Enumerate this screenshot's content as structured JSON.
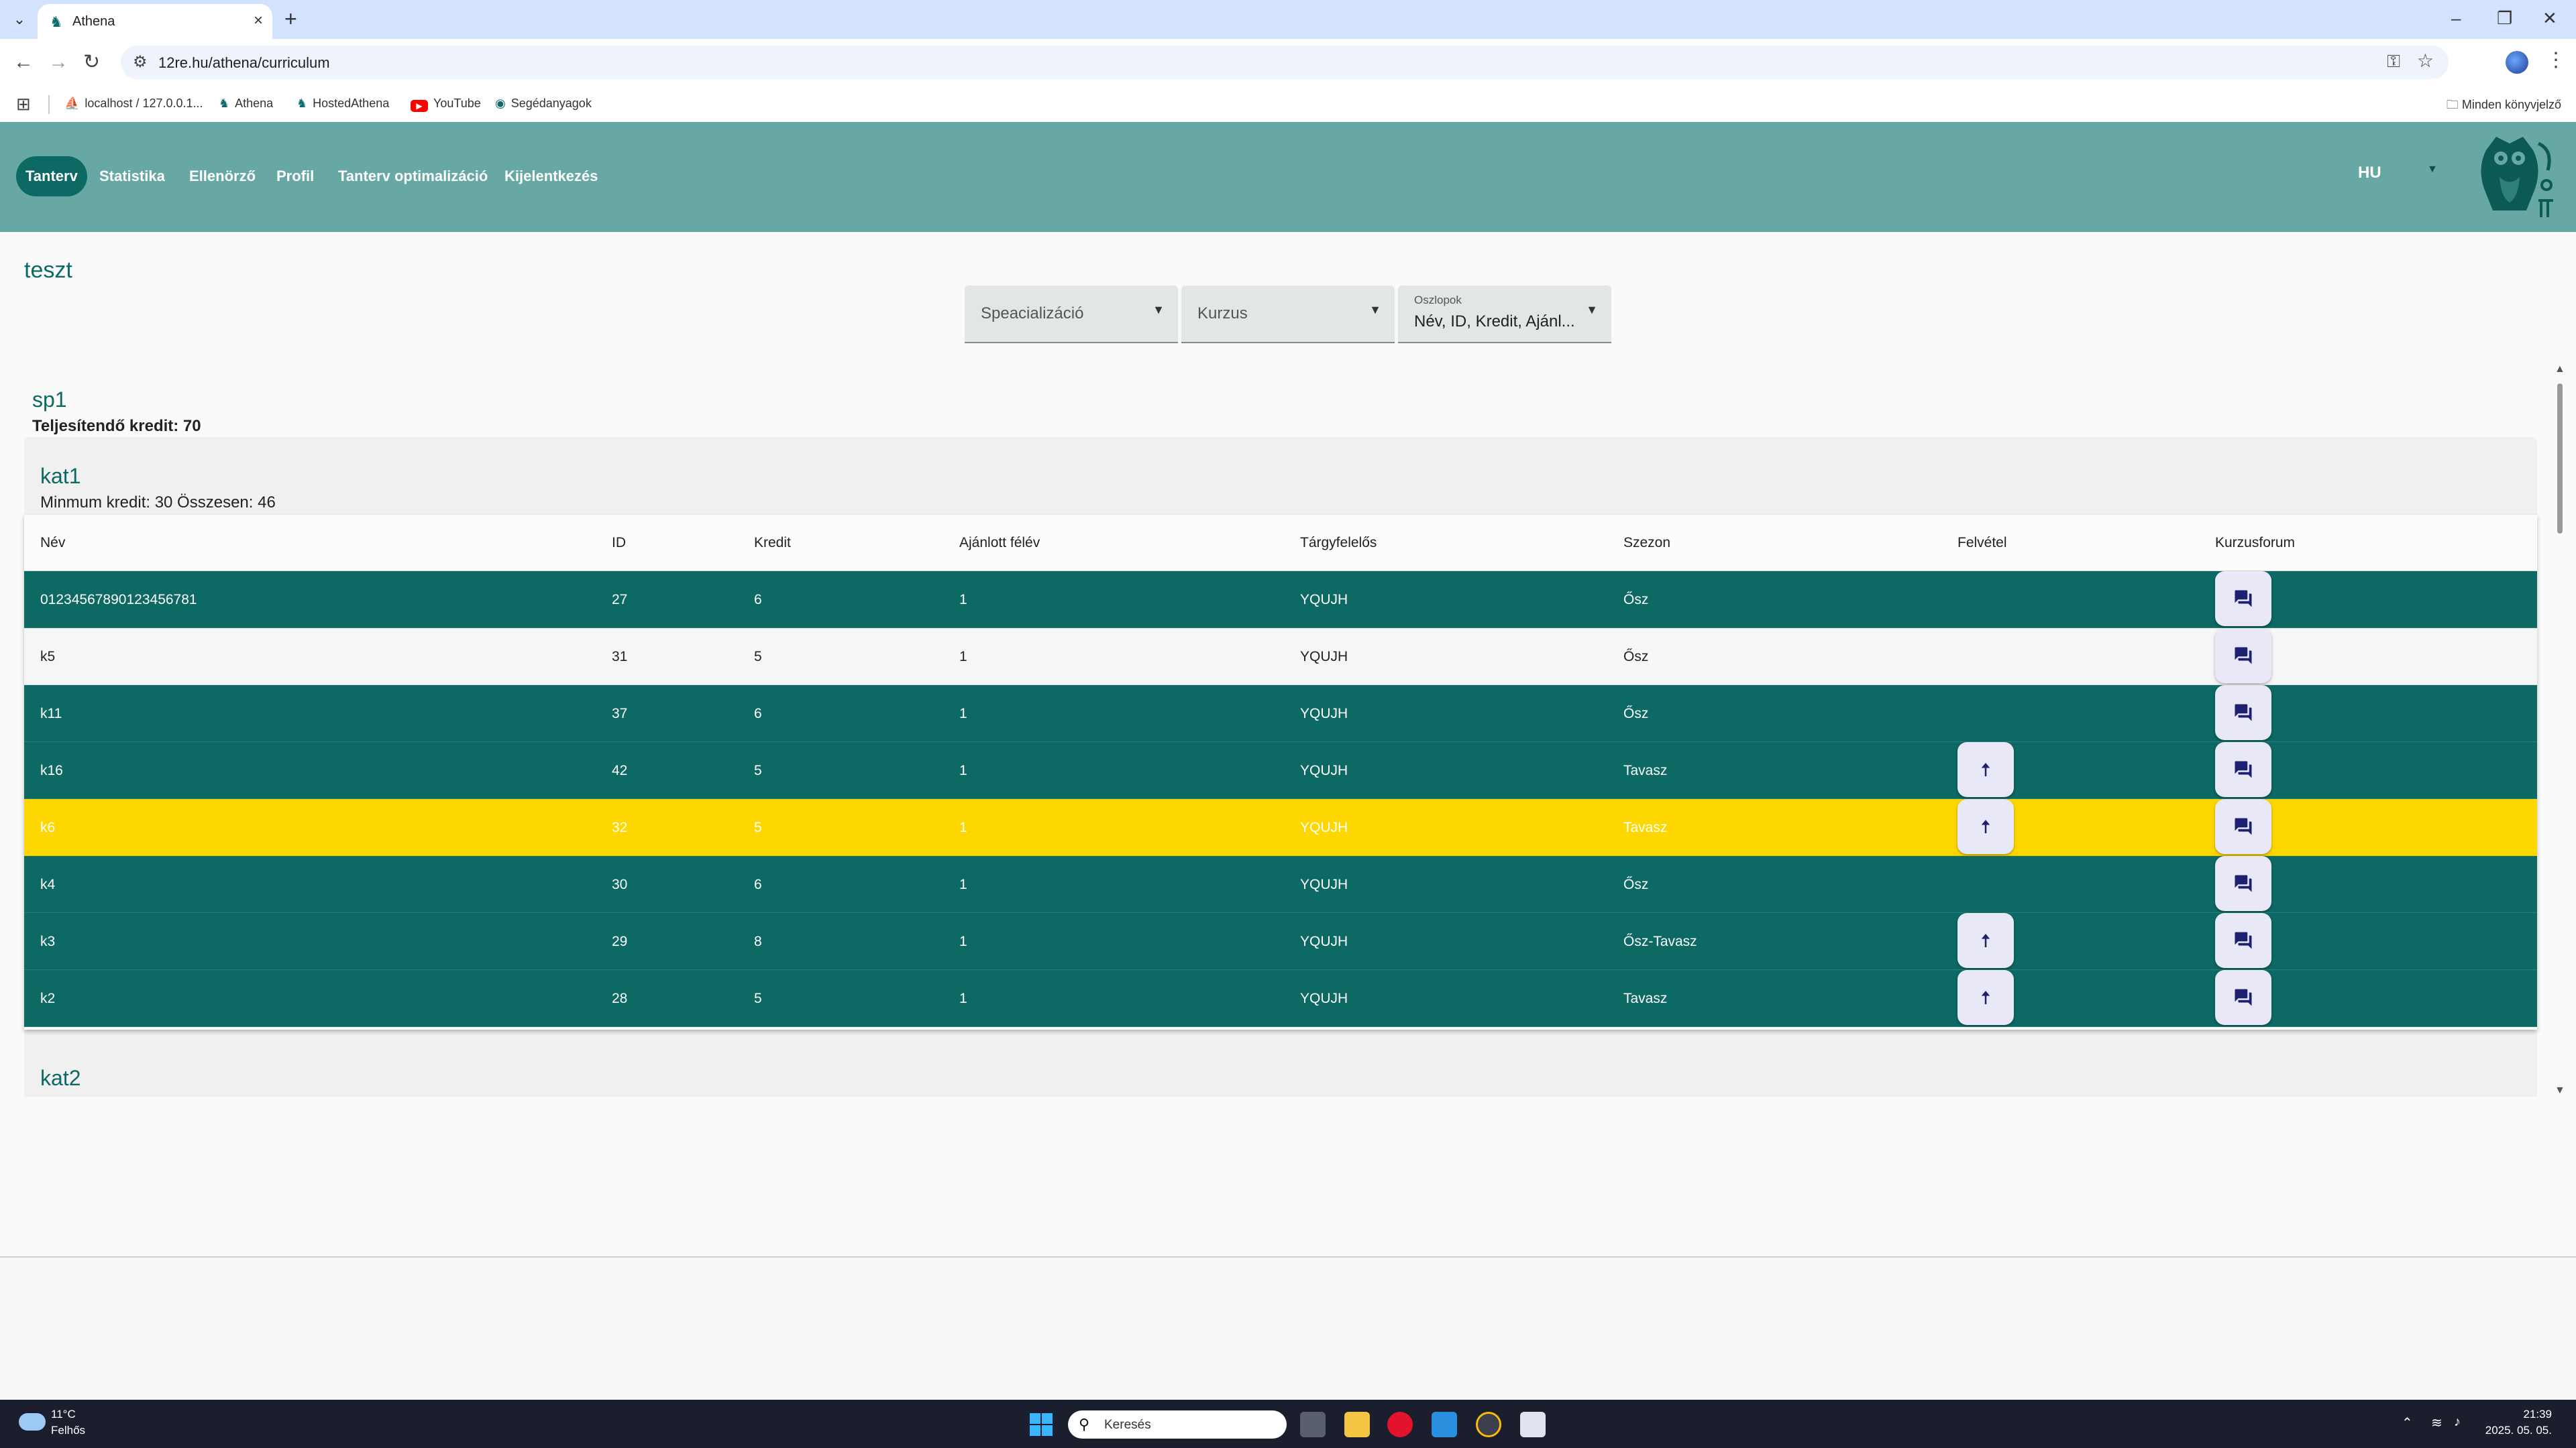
{
  "browser": {
    "tab_title": "Athena",
    "tab_close": "×",
    "new_tab": "+",
    "url": "12re.hu/athena/curriculum",
    "bookmarks": [
      "localhost / 127.0.0.1...",
      "Athena",
      "HostedAthena",
      "YouTube",
      "Segédanyagok"
    ],
    "all_bookmarks": "Minden könyvjelző",
    "window_controls": [
      "–",
      "❐",
      "✕"
    ],
    "icons": [
      "back-icon",
      "forward-icon",
      "reload-icon",
      "tune-icon",
      "key-icon",
      "star-icon",
      "profile-icon",
      "kebab-icon"
    ]
  },
  "nav": {
    "items": [
      "Tanterv",
      "Statistika",
      "Ellenörző",
      "Profil",
      "Tanterv optimalizáció",
      "Kijelentkezés"
    ],
    "active": "Tanterv",
    "lang": "HU"
  },
  "page": {
    "title": "teszt",
    "filters": {
      "specialization": "Speacializáció",
      "course": "Kurzus",
      "columns_label": "Oszlopok",
      "columns_value": "Név, ID, Kredit, Ajánl..."
    },
    "sp": {
      "title": "sp1",
      "credit": "Teljesítendő kredit: 70"
    },
    "kat1": {
      "title": "kat1",
      "credit": "Minmum kredit: 30 Összesen: 46"
    },
    "kat2": {
      "title": "kat2"
    }
  },
  "table": {
    "headers": [
      "Név",
      "ID",
      "Kredit",
      "Ajánlott félév",
      "Tárgyfelelős",
      "Szezon",
      "Felvétel",
      "Kurzusforum"
    ],
    "rows": [
      {
        "name": "01234567890123456781",
        "id": "27",
        "credit": "6",
        "semester": "1",
        "owner": "YQUJH",
        "season": "Ősz",
        "enroll": false,
        "style": "teal"
      },
      {
        "name": "k5",
        "id": "31",
        "credit": "5",
        "semester": "1",
        "owner": "YQUJH",
        "season": "Ősz",
        "enroll": false,
        "style": "light"
      },
      {
        "name": "k11",
        "id": "37",
        "credit": "6",
        "semester": "1",
        "owner": "YQUJH",
        "season": "Ősz",
        "enroll": false,
        "style": "teal"
      },
      {
        "name": "k16",
        "id": "42",
        "credit": "5",
        "semester": "1",
        "owner": "YQUJH",
        "season": "Tavasz",
        "enroll": true,
        "style": "teal"
      },
      {
        "name": "k6",
        "id": "32",
        "credit": "5",
        "semester": "1",
        "owner": "YQUJH",
        "season": "Tavasz",
        "enroll": true,
        "style": "yellow"
      },
      {
        "name": "k4",
        "id": "30",
        "credit": "6",
        "semester": "1",
        "owner": "YQUJH",
        "season": "Ősz",
        "enroll": false,
        "style": "teal"
      },
      {
        "name": "k3",
        "id": "29",
        "credit": "8",
        "semester": "1",
        "owner": "YQUJH",
        "season": "Ősz-Tavasz",
        "enroll": true,
        "style": "teal"
      },
      {
        "name": "k2",
        "id": "28",
        "credit": "5",
        "semester": "1",
        "owner": "YQUJH",
        "season": "Tavasz",
        "enroll": true,
        "style": "teal"
      }
    ]
  },
  "taskbar": {
    "weather_temp": "11°C",
    "weather_desc": "Felhős",
    "search_placeholder": "Keresés",
    "time": "21:39",
    "date": "2025. 05. 05."
  },
  "colors": {
    "header": "#68a8a4",
    "row_teal": "#0c6964",
    "row_highlight": "#ffd700",
    "accent": "#0c6964"
  }
}
